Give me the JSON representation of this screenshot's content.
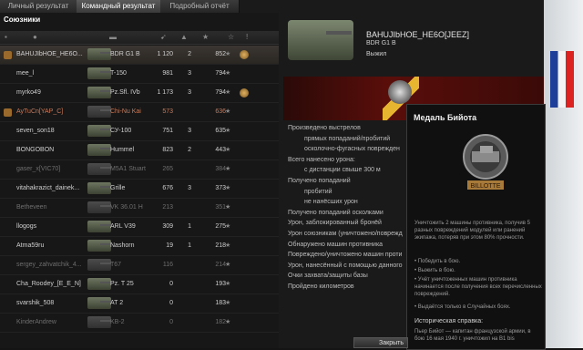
{
  "tabs": [
    "Личный результат",
    "Командный результат",
    "Подробный отчёт"
  ],
  "team": {
    "title": "Союзники"
  },
  "players": [
    {
      "nick": "BAHUJIbHOE_HE6O...",
      "tank": "BDR G1 B",
      "dmg": "1 120",
      "kills": "2",
      "xp": "852",
      "medal": true,
      "me": true,
      "dead": false,
      "plat": false
    },
    {
      "nick": "mee_l",
      "tank": "T-150",
      "dmg": "981",
      "kills": "3",
      "xp": "794",
      "medal": false,
      "me": false,
      "dead": false,
      "plat": false
    },
    {
      "nick": "myrko49",
      "tank": "Pz.Sfl. IVb",
      "dmg": "1 173",
      "kills": "3",
      "xp": "794",
      "medal": true,
      "me": false,
      "dead": false,
      "plat": false
    },
    {
      "nick": "AyTuCn[YAP_C]",
      "tank": "Chi-Nu Kai",
      "dmg": "573",
      "kills": "",
      "xp": "636",
      "medal": false,
      "me": false,
      "dead": true,
      "plat": true
    },
    {
      "nick": "seven_son18",
      "tank": "СУ-100",
      "dmg": "751",
      "kills": "3",
      "xp": "635",
      "medal": false,
      "me": false,
      "dead": false,
      "plat": false
    },
    {
      "nick": "BONGOBON",
      "tank": "Hummel",
      "dmg": "823",
      "kills": "2",
      "xp": "443",
      "medal": false,
      "me": false,
      "dead": false,
      "plat": false
    },
    {
      "nick": "gaser_x[VIC70]",
      "tank": "M5A1 Stuart",
      "dmg": "265",
      "kills": "",
      "xp": "384",
      "medal": false,
      "me": false,
      "dead": true,
      "plat": false
    },
    {
      "nick": "vitahakrazict_dainek...",
      "tank": "Grille",
      "dmg": "676",
      "kills": "3",
      "xp": "373",
      "medal": false,
      "me": false,
      "dead": false,
      "plat": false
    },
    {
      "nick": "Betheveen",
      "tank": "VK 36.01 H",
      "dmg": "213",
      "kills": "",
      "xp": "351",
      "medal": false,
      "me": false,
      "dead": true,
      "plat": false
    },
    {
      "nick": "llogogs",
      "tank": "ARL V39",
      "dmg": "309",
      "kills": "1",
      "xp": "275",
      "medal": false,
      "me": false,
      "dead": false,
      "plat": false
    },
    {
      "nick": "Atma59ru",
      "tank": "Nashorn",
      "dmg": "19",
      "kills": "1",
      "xp": "218",
      "medal": false,
      "me": false,
      "dead": false,
      "plat": false
    },
    {
      "nick": "sergey_zahvatchik_4...",
      "tank": "T67",
      "dmg": "116",
      "kills": "",
      "xp": "214",
      "medal": false,
      "me": false,
      "dead": true,
      "plat": false
    },
    {
      "nick": "Cha_Roodey_[E_E_N]",
      "tank": "Pz. T 25",
      "dmg": "0",
      "kills": "",
      "xp": "193",
      "medal": false,
      "me": false,
      "dead": false,
      "plat": false
    },
    {
      "nick": "svarshik_508",
      "tank": "AT 2",
      "dmg": "0",
      "kills": "",
      "xp": "183",
      "medal": false,
      "me": false,
      "dead": false,
      "plat": false
    },
    {
      "nick": "KinderAndrew",
      "tank": "KB-2",
      "dmg": "0",
      "kills": "",
      "xp": "182",
      "medal": false,
      "me": false,
      "dead": true,
      "plat": false
    }
  ],
  "detail": {
    "player_name": "BAHUJIbHOE_HE6O[JEEZ]",
    "vehicle": "BDR G1 B",
    "status": "Выжил",
    "stats": [
      "Произведено выстрелов",
      "прямых попаданий/пробитий",
      "осколочно-фугасных поврежден",
      "Всего нанесено урона:",
      "с дистанции свыше 300 м",
      "Получено попаданий",
      "пробитий",
      "не нанёсших урон",
      "Получено попаданий осколками",
      "Урон, заблокированный бронёй",
      "Урон союзникам (уничтожено/поврежд",
      "Обнаружено машин противника",
      "Повреждено/уничтожено машин проти",
      "Урон, нанесённый с помощью данного",
      "Очки захвата/защиты базы",
      "Пройдено километров"
    ]
  },
  "popup": {
    "title": "Медаль Бийота",
    "medal_ribbon": "BILLOTTE",
    "desc": "Уничтожить 2 машины противника, получив 5 разных повреждений модулей или ранений экипажа, потеряв при этом 80% прочности.",
    "bullets": [
      "• Победить в бою.",
      "• Выжить в бою.",
      "• Учёт уничтоженных машин противника начинается после получения всех перечисленных повреждений.",
      "• Выдаётся только в Случайных боях."
    ],
    "history_title": "Историческая справка:",
    "history_text": "Пьер Бийот — капитан французской армии, в бою 16 мая 1940 г. уничтожил на В1 bis"
  },
  "close_label": "Закрыть"
}
